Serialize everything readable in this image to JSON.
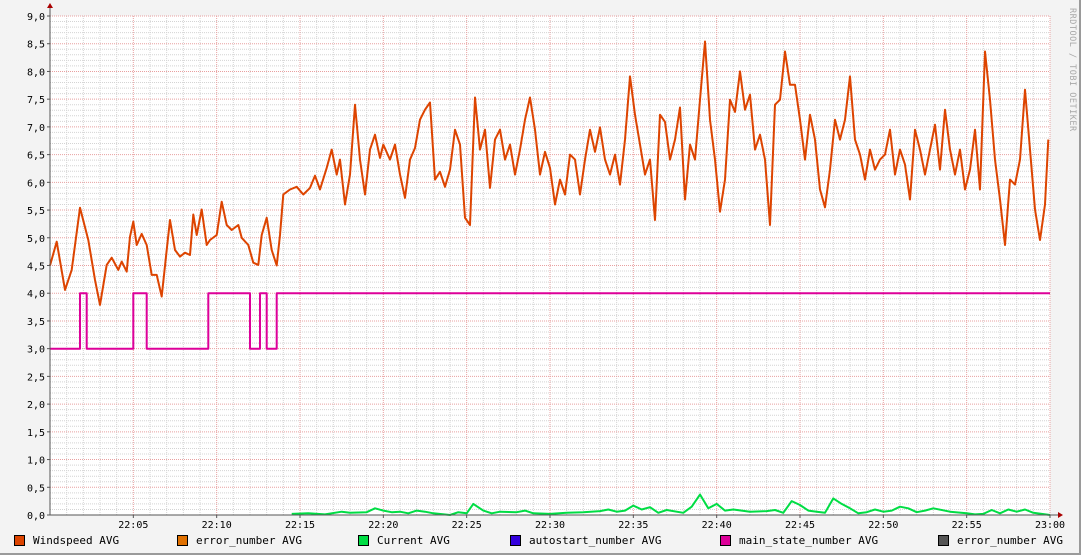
{
  "watermark": "RRDTOOL / TOBI OETIKER",
  "chart_data": {
    "type": "line",
    "title": "",
    "xlabel": "",
    "ylabel": "",
    "x_unit": "minutes after 22:00",
    "xlim": [
      0,
      60
    ],
    "ylim": [
      0,
      9
    ],
    "grid": true,
    "legend_position": "bottom",
    "x_ticks": [
      {
        "v": 5,
        "label": "22:05"
      },
      {
        "v": 10,
        "label": "22:10"
      },
      {
        "v": 15,
        "label": "22:15"
      },
      {
        "v": 20,
        "label": "22:20"
      },
      {
        "v": 25,
        "label": "22:25"
      },
      {
        "v": 30,
        "label": "22:30"
      },
      {
        "v": 35,
        "label": "22:35"
      },
      {
        "v": 40,
        "label": "22:40"
      },
      {
        "v": 45,
        "label": "22:45"
      },
      {
        "v": 50,
        "label": "22:50"
      },
      {
        "v": 55,
        "label": "22:55"
      },
      {
        "v": 60,
        "label": "23:00"
      }
    ],
    "y_ticks": [
      {
        "v": 0,
        "label": "0,0"
      },
      {
        "v": 0.5,
        "label": "0,5"
      },
      {
        "v": 1,
        "label": "1,0"
      },
      {
        "v": 1.5,
        "label": "1,5"
      },
      {
        "v": 2,
        "label": "2,0"
      },
      {
        "v": 2.5,
        "label": "2,5"
      },
      {
        "v": 3,
        "label": "3,0"
      },
      {
        "v": 3.5,
        "label": "3,5"
      },
      {
        "v": 4,
        "label": "4,0"
      },
      {
        "v": 4.5,
        "label": "4,5"
      },
      {
        "v": 5,
        "label": "5,0"
      },
      {
        "v": 5.5,
        "label": "5,5"
      },
      {
        "v": 6,
        "label": "6,0"
      },
      {
        "v": 6.5,
        "label": "6,5"
      },
      {
        "v": 7,
        "label": "7,0"
      },
      {
        "v": 7.5,
        "label": "7,5"
      },
      {
        "v": 8,
        "label": "8,0"
      },
      {
        "v": 8.5,
        "label": "8,5"
      },
      {
        "v": 9,
        "label": "9,0"
      }
    ],
    "series": [
      {
        "name": "Windspeed AVG",
        "color": "#dd4400",
        "step": false,
        "points": [
          [
            0,
            4.5
          ],
          [
            0.4,
            4.93
          ],
          [
            0.9,
            4.06
          ],
          [
            1.3,
            4.42
          ],
          [
            1.8,
            5.54
          ],
          [
            2.3,
            4.96
          ],
          [
            2.7,
            4.24
          ],
          [
            3.0,
            3.79
          ],
          [
            3.4,
            4.51
          ],
          [
            3.7,
            4.64
          ],
          [
            4.1,
            4.42
          ],
          [
            4.3,
            4.57
          ],
          [
            4.6,
            4.39
          ],
          [
            4.8,
            5.02
          ],
          [
            5.0,
            5.29
          ],
          [
            5.2,
            4.87
          ],
          [
            5.5,
            5.07
          ],
          [
            5.8,
            4.87
          ],
          [
            6.1,
            4.33
          ],
          [
            6.4,
            4.33
          ],
          [
            6.7,
            3.94
          ],
          [
            7.0,
            4.78
          ],
          [
            7.2,
            5.32
          ],
          [
            7.5,
            4.78
          ],
          [
            7.8,
            4.66
          ],
          [
            8.1,
            4.73
          ],
          [
            8.4,
            4.69
          ],
          [
            8.6,
            5.42
          ],
          [
            8.8,
            5.05
          ],
          [
            9.1,
            5.51
          ],
          [
            9.4,
            4.87
          ],
          [
            9.6,
            4.96
          ],
          [
            10.0,
            5.05
          ],
          [
            10.3,
            5.65
          ],
          [
            10.6,
            5.23
          ],
          [
            10.9,
            5.14
          ],
          [
            11.3,
            5.23
          ],
          [
            11.5,
            5.0
          ],
          [
            11.9,
            4.87
          ],
          [
            12.2,
            4.55
          ],
          [
            12.5,
            4.51
          ],
          [
            12.7,
            5.05
          ],
          [
            13.0,
            5.36
          ],
          [
            13.3,
            4.78
          ],
          [
            13.6,
            4.5
          ],
          [
            13.8,
            5.05
          ],
          [
            14.0,
            5.78
          ],
          [
            14.4,
            5.87
          ],
          [
            14.8,
            5.92
          ],
          [
            15.2,
            5.78
          ],
          [
            15.6,
            5.9
          ],
          [
            15.9,
            6.12
          ],
          [
            16.2,
            5.87
          ],
          [
            16.6,
            6.26
          ],
          [
            16.9,
            6.59
          ],
          [
            17.2,
            6.14
          ],
          [
            17.4,
            6.41
          ],
          [
            17.7,
            5.6
          ],
          [
            18.0,
            6.14
          ],
          [
            18.3,
            7.4
          ],
          [
            18.6,
            6.41
          ],
          [
            18.9,
            5.78
          ],
          [
            19.2,
            6.59
          ],
          [
            19.5,
            6.86
          ],
          [
            19.8,
            6.44
          ],
          [
            20.0,
            6.68
          ],
          [
            20.4,
            6.41
          ],
          [
            20.7,
            6.68
          ],
          [
            21.0,
            6.14
          ],
          [
            21.3,
            5.72
          ],
          [
            21.6,
            6.41
          ],
          [
            21.9,
            6.62
          ],
          [
            22.2,
            7.13
          ],
          [
            22.5,
            7.31
          ],
          [
            22.8,
            7.44
          ],
          [
            23.1,
            6.05
          ],
          [
            23.4,
            6.19
          ],
          [
            23.7,
            5.92
          ],
          [
            24.0,
            6.23
          ],
          [
            24.3,
            6.95
          ],
          [
            24.6,
            6.68
          ],
          [
            24.9,
            5.36
          ],
          [
            25.2,
            5.23
          ],
          [
            25.5,
            7.53
          ],
          [
            25.8,
            6.59
          ],
          [
            26.1,
            6.95
          ],
          [
            26.4,
            5.9
          ],
          [
            26.7,
            6.77
          ],
          [
            27.0,
            6.95
          ],
          [
            27.3,
            6.41
          ],
          [
            27.6,
            6.68
          ],
          [
            27.9,
            6.14
          ],
          [
            28.2,
            6.59
          ],
          [
            28.5,
            7.13
          ],
          [
            28.8,
            7.53
          ],
          [
            29.1,
            6.95
          ],
          [
            29.4,
            6.14
          ],
          [
            29.7,
            6.55
          ],
          [
            30.0,
            6.26
          ],
          [
            30.3,
            5.6
          ],
          [
            30.6,
            6.05
          ],
          [
            30.9,
            5.78
          ],
          [
            31.2,
            6.5
          ],
          [
            31.5,
            6.41
          ],
          [
            31.8,
            5.78
          ],
          [
            32.1,
            6.41
          ],
          [
            32.4,
            6.95
          ],
          [
            32.7,
            6.55
          ],
          [
            33.0,
            6.99
          ],
          [
            33.3,
            6.41
          ],
          [
            33.6,
            6.14
          ],
          [
            33.9,
            6.5
          ],
          [
            34.2,
            5.96
          ],
          [
            34.5,
            6.77
          ],
          [
            34.8,
            7.91
          ],
          [
            35.1,
            7.22
          ],
          [
            35.4,
            6.68
          ],
          [
            35.7,
            6.14
          ],
          [
            36.0,
            6.41
          ],
          [
            36.3,
            5.32
          ],
          [
            36.6,
            7.22
          ],
          [
            36.9,
            7.09
          ],
          [
            37.2,
            6.41
          ],
          [
            37.5,
            6.77
          ],
          [
            37.8,
            7.35
          ],
          [
            38.1,
            5.69
          ],
          [
            38.4,
            6.68
          ],
          [
            38.7,
            6.41
          ],
          [
            39.0,
            7.49
          ],
          [
            39.3,
            8.54
          ],
          [
            39.6,
            7.13
          ],
          [
            39.9,
            6.41
          ],
          [
            40.2,
            5.47
          ],
          [
            40.5,
            6.05
          ],
          [
            40.8,
            7.49
          ],
          [
            41.1,
            7.27
          ],
          [
            41.4,
            8.0
          ],
          [
            41.7,
            7.31
          ],
          [
            42.0,
            7.58
          ],
          [
            42.3,
            6.59
          ],
          [
            42.6,
            6.86
          ],
          [
            42.9,
            6.41
          ],
          [
            43.2,
            5.23
          ],
          [
            43.5,
            7.4
          ],
          [
            43.8,
            7.49
          ],
          [
            44.1,
            8.36
          ],
          [
            44.4,
            7.76
          ],
          [
            44.7,
            7.76
          ],
          [
            45.0,
            7.13
          ],
          [
            45.3,
            6.41
          ],
          [
            45.6,
            7.22
          ],
          [
            45.9,
            6.77
          ],
          [
            46.2,
            5.87
          ],
          [
            46.5,
            5.55
          ],
          [
            46.8,
            6.23
          ],
          [
            47.1,
            7.13
          ],
          [
            47.4,
            6.77
          ],
          [
            47.7,
            7.13
          ],
          [
            48.0,
            7.91
          ],
          [
            48.3,
            6.77
          ],
          [
            48.6,
            6.5
          ],
          [
            48.9,
            6.05
          ],
          [
            49.2,
            6.59
          ],
          [
            49.5,
            6.23
          ],
          [
            49.8,
            6.41
          ],
          [
            50.1,
            6.5
          ],
          [
            50.4,
            6.95
          ],
          [
            50.7,
            6.14
          ],
          [
            51.0,
            6.59
          ],
          [
            51.3,
            6.32
          ],
          [
            51.6,
            5.69
          ],
          [
            51.9,
            6.95
          ],
          [
            52.2,
            6.59
          ],
          [
            52.5,
            6.14
          ],
          [
            52.8,
            6.59
          ],
          [
            53.1,
            7.04
          ],
          [
            53.4,
            6.23
          ],
          [
            53.7,
            7.31
          ],
          [
            54.0,
            6.59
          ],
          [
            54.3,
            6.14
          ],
          [
            54.6,
            6.59
          ],
          [
            54.9,
            5.87
          ],
          [
            55.2,
            6.23
          ],
          [
            55.5,
            6.95
          ],
          [
            55.8,
            5.87
          ],
          [
            56.1,
            8.36
          ],
          [
            56.4,
            7.49
          ],
          [
            56.7,
            6.41
          ],
          [
            57.0,
            5.69
          ],
          [
            57.3,
            4.87
          ],
          [
            57.6,
            6.05
          ],
          [
            57.9,
            5.96
          ],
          [
            58.2,
            6.41
          ],
          [
            58.5,
            7.67
          ],
          [
            58.8,
            6.59
          ],
          [
            59.1,
            5.51
          ],
          [
            59.4,
            4.96
          ],
          [
            59.7,
            5.6
          ],
          [
            59.9,
            6.77
          ]
        ]
      },
      {
        "name": "error_number AVG",
        "color": "#e07000",
        "step": false,
        "points": []
      },
      {
        "name": "Current AVG",
        "color": "#00dd44",
        "step": false,
        "points": [
          [
            14.5,
            0.02
          ],
          [
            15.5,
            0.03
          ],
          [
            16.5,
            0.01
          ],
          [
            17.5,
            0.06
          ],
          [
            18,
            0.04
          ],
          [
            19,
            0.05
          ],
          [
            19.5,
            0.12
          ],
          [
            20,
            0.08
          ],
          [
            20.5,
            0.05
          ],
          [
            21,
            0.06
          ],
          [
            21.5,
            0.03
          ],
          [
            22,
            0.08
          ],
          [
            22.5,
            0.06
          ],
          [
            23,
            0.03
          ],
          [
            24,
            0.0
          ],
          [
            24.5,
            0.05
          ],
          [
            25,
            0.03
          ],
          [
            25.4,
            0.2
          ],
          [
            26,
            0.08
          ],
          [
            26.5,
            0.03
          ],
          [
            27,
            0.06
          ],
          [
            28,
            0.05
          ],
          [
            28.5,
            0.08
          ],
          [
            29,
            0.03
          ],
          [
            30,
            0.02
          ],
          [
            31,
            0.04
          ],
          [
            32,
            0.05
          ],
          [
            33,
            0.07
          ],
          [
            33.5,
            0.1
          ],
          [
            34,
            0.06
          ],
          [
            34.5,
            0.08
          ],
          [
            35,
            0.17
          ],
          [
            35.5,
            0.1
          ],
          [
            36,
            0.14
          ],
          [
            36.5,
            0.04
          ],
          [
            37,
            0.09
          ],
          [
            38,
            0.04
          ],
          [
            38.5,
            0.15
          ],
          [
            39,
            0.37
          ],
          [
            39.5,
            0.12
          ],
          [
            40,
            0.2
          ],
          [
            40.5,
            0.08
          ],
          [
            41,
            0.1
          ],
          [
            42,
            0.06
          ],
          [
            43,
            0.07
          ],
          [
            43.5,
            0.09
          ],
          [
            44,
            0.04
          ],
          [
            44.5,
            0.25
          ],
          [
            45,
            0.18
          ],
          [
            45.5,
            0.08
          ],
          [
            46,
            0.06
          ],
          [
            46.5,
            0.04
          ],
          [
            47,
            0.3
          ],
          [
            47.5,
            0.2
          ],
          [
            48,
            0.12
          ],
          [
            48.5,
            0.03
          ],
          [
            49,
            0.05
          ],
          [
            49.5,
            0.1
          ],
          [
            50,
            0.06
          ],
          [
            50.5,
            0.08
          ],
          [
            51,
            0.15
          ],
          [
            51.5,
            0.12
          ],
          [
            52,
            0.05
          ],
          [
            52.5,
            0.08
          ],
          [
            53,
            0.12
          ],
          [
            54,
            0.06
          ],
          [
            55,
            0.03
          ],
          [
            55.5,
            0.01
          ],
          [
            56,
            0.02
          ],
          [
            56.5,
            0.09
          ],
          [
            57,
            0.03
          ],
          [
            57.5,
            0.1
          ],
          [
            58,
            0.06
          ],
          [
            58.5,
            0.1
          ],
          [
            59,
            0.04
          ],
          [
            60,
            0.0
          ]
        ]
      },
      {
        "name": "autostart_number AVG",
        "color": "#3300dd",
        "step": false,
        "points": []
      },
      {
        "name": "main_state_number AVG",
        "color": "#dd0099",
        "step": true,
        "points": [
          [
            0,
            3
          ],
          [
            1.8,
            4
          ],
          [
            2.2,
            3
          ],
          [
            5.0,
            4
          ],
          [
            5.8,
            3
          ],
          [
            9.5,
            4
          ],
          [
            12.0,
            3
          ],
          [
            12.6,
            4
          ],
          [
            13.0,
            3
          ],
          [
            13.6,
            4
          ],
          [
            60,
            4
          ]
        ]
      },
      {
        "name": "error_number AVG",
        "color": "#555555",
        "step": false,
        "points": []
      }
    ]
  }
}
